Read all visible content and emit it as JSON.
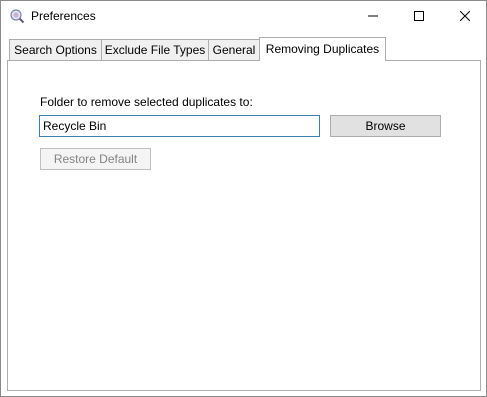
{
  "window": {
    "title": "Preferences",
    "icons": {
      "app": "preferences-app-icon",
      "minimize": "minimize-icon",
      "maximize": "maximize-icon",
      "close": "close-icon"
    }
  },
  "tabs": [
    {
      "label": "Search Options",
      "selected": false
    },
    {
      "label": "Exclude File Types",
      "selected": false
    },
    {
      "label": "General",
      "selected": false
    },
    {
      "label": "Removing Duplicates",
      "selected": true
    }
  ],
  "removing_duplicates": {
    "folder_label": "Folder to remove selected duplicates to:",
    "folder_value": "Recycle Bin",
    "browse_label": "Browse",
    "restore_label": "Restore Default",
    "restore_enabled": false
  },
  "colors": {
    "input_border": "#3c7fb1",
    "button_face": "#e1e1e1",
    "disabled_text": "#838383"
  }
}
